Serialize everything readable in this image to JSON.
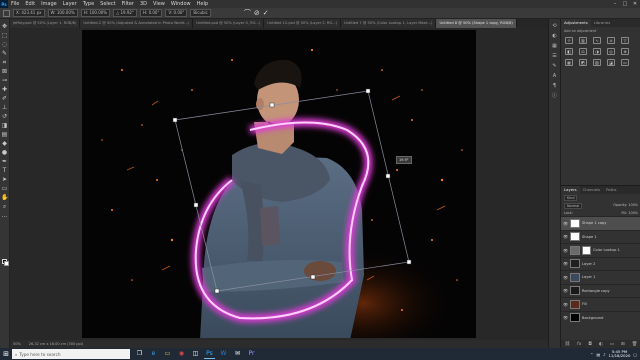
{
  "menu": {
    "logo": "Ps",
    "items": [
      "File",
      "Edit",
      "Image",
      "Layer",
      "Type",
      "Select",
      "Filter",
      "3D",
      "View",
      "Window",
      "Help"
    ]
  },
  "options": {
    "x": "X: 423.41 px",
    "w": "W: 100.00%",
    "h": "H: 100.00%",
    "angle": "△ 19.92°",
    "h_skew": "H: 0.00°",
    "v_skew": "V: 0.00°",
    "interp": "Bicubic"
  },
  "tabs": [
    {
      "label": "Jeffrey.psd @ 50% (Layer 1, RGB/8)",
      "active": false
    },
    {
      "label": "Untitled-2 @ 50% (Adjusted & Annotated in Photo World...)",
      "active": false
    },
    {
      "label": "Untitled.psd @ 50% (Layer 0, RG...)",
      "active": false
    },
    {
      "label": "Untitled 12.psd @ 50% (Layer 2, RG...)",
      "active": false
    },
    {
      "label": "Untitled 7 @ 50% (Color Lookup 1, Layer Mask...)",
      "active": false
    },
    {
      "label": "Untitled 8 @ 50% (Shape 1 copy, RGB/8)",
      "active": true
    }
  ],
  "canvas": {
    "angle_label": "19.9°"
  },
  "status": {
    "zoom": "50%",
    "doc": "26.32 cm x 16.00 cm (300 ppi)"
  },
  "adjustments": {
    "tab": "Adjustments",
    "tab2": "Libraries",
    "subtitle": "Add an adjustment"
  },
  "layers_panel": {
    "tabs": [
      "Layers",
      "Channels",
      "Paths"
    ],
    "kind": "Kind",
    "blend": "Normal",
    "opacity": "Opacity: 100%",
    "lock": "Lock:",
    "fill": "Fill: 100%",
    "rows": [
      {
        "name": "Shape 1 copy",
        "sel": true,
        "thumb": "#ffffff",
        "mask": false
      },
      {
        "name": "Shape 1",
        "sel": false,
        "thumb": "#ffffff",
        "mask": false
      },
      {
        "name": "Color Lookup 1",
        "sel": false,
        "thumb": "#6a6a6a",
        "mask": true
      },
      {
        "name": "Layer 2",
        "sel": false,
        "thumb": "#202020",
        "mask": false
      },
      {
        "name": "Layer 1",
        "sel": false,
        "thumb": "#3a4a5c",
        "mask": false
      },
      {
        "name": "Rectangle copy",
        "sel": false,
        "thumb": "#1a1a1a",
        "mask": false
      },
      {
        "name": "Fill",
        "sel": false,
        "thumb": "#5a2a1a",
        "mask": false
      },
      {
        "name": "Background",
        "sel": false,
        "thumb": "#000000",
        "mask": false
      }
    ]
  },
  "taskbar": {
    "search_placeholder": "Type here to search",
    "time": "5:45 PM",
    "date": "11/18/2020"
  }
}
